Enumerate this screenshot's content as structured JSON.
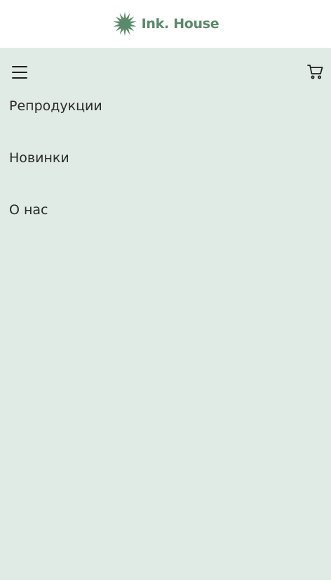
{
  "header": {
    "brand_name": "Ink. House",
    "logo_icon": "starburst-icon",
    "brand_color": "#5a8a6a"
  },
  "menu": {
    "toggle_icon": "hamburger-icon",
    "cart_icon": "cart-icon",
    "items": [
      {
        "label": "Репродукции"
      },
      {
        "label": "Новинки"
      },
      {
        "label": "О нас"
      }
    ]
  },
  "colors": {
    "header_bg": "#ffffff",
    "menu_bg": "#e1ebe5",
    "text": "#2a2a2a"
  }
}
